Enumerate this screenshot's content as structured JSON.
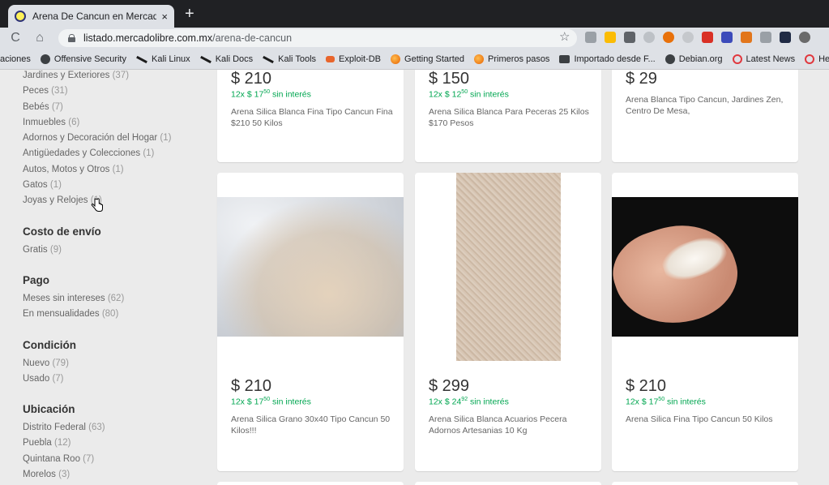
{
  "browser": {
    "tab_title": "Arena De Cancun en Mercado Libre",
    "tab_close": "×",
    "new_tab": "+",
    "back": "C",
    "home": "⌂",
    "url_host": "listado.mercadolibre.com.mx",
    "url_path": "/arena-de-cancun",
    "star": "☆"
  },
  "bookmarks": [
    {
      "label": "aciones",
      "icon": ""
    },
    {
      "label": "Offensive Security",
      "icon": "globe"
    },
    {
      "label": "Kali Linux",
      "icon": "kali"
    },
    {
      "label": "Kali Docs",
      "icon": "kali"
    },
    {
      "label": "Kali Tools",
      "icon": "kali"
    },
    {
      "label": "Exploit-DB",
      "icon": "exploit"
    },
    {
      "label": "Getting Started",
      "icon": "firefox"
    },
    {
      "label": "Primeros pasos",
      "icon": "firefox"
    },
    {
      "label": "Importado desde F...",
      "icon": "folder"
    },
    {
      "label": "Debian.org",
      "icon": "globe"
    },
    {
      "label": "Latest News",
      "icon": "rss"
    },
    {
      "label": "Help",
      "icon": "rss"
    }
  ],
  "sidebar": {
    "top_items": [
      {
        "label": "Jardines y Exteriores",
        "count": "(37)"
      },
      {
        "label": "Peces",
        "count": "(31)"
      },
      {
        "label": "Bebés",
        "count": "(7)"
      },
      {
        "label": "Inmuebles",
        "count": "(6)"
      },
      {
        "label": "Adornos y Decoración del Hogar",
        "count": "(1)"
      },
      {
        "label": "Antigüedades y Colecciones",
        "count": "(1)"
      },
      {
        "label": "Autos, Motos y Otros",
        "count": "(1)"
      },
      {
        "label": "Gatos",
        "count": "(1)"
      },
      {
        "label": "Joyas y Relojes",
        "count": "(1)"
      }
    ],
    "shipping": {
      "heading": "Costo de envío",
      "items": [
        {
          "label": "Gratis",
          "count": "(9)"
        }
      ]
    },
    "payment": {
      "heading": "Pago",
      "items": [
        {
          "label": "Meses sin intereses",
          "count": "(62)"
        },
        {
          "label": "En mensualidades",
          "count": "(80)"
        }
      ]
    },
    "condition": {
      "heading": "Condición",
      "items": [
        {
          "label": "Nuevo",
          "count": "(79)"
        },
        {
          "label": "Usado",
          "count": "(7)"
        }
      ]
    },
    "location": {
      "heading": "Ubicación",
      "items": [
        {
          "label": "Distrito Federal",
          "count": "(63)"
        },
        {
          "label": "Puebla",
          "count": "(12)"
        },
        {
          "label": "Quintana Roo",
          "count": "(7)"
        },
        {
          "label": "Morelos",
          "count": "(3)"
        }
      ]
    }
  },
  "results_row1": [
    {
      "price": "$ 210",
      "install_prefix": "12x $ 17",
      "install_cents": "50",
      "install_suffix": "sin interés",
      "title": "Arena Silica Blanca Fina Tipo Cancun Fina $210 50 Kilos"
    },
    {
      "price": "$ 150",
      "install_prefix": "12x $ 12",
      "install_cents": "50",
      "install_suffix": "sin interés",
      "title": "Arena Silica Blanca Para Peceras 25 Kilos $170 Pesos"
    },
    {
      "price": "$ 29",
      "title": "Arena Blanca Tipo Cancun, Jardines Zen, Centro De Mesa,"
    }
  ],
  "results_row2": [
    {
      "price": "$ 210",
      "install_prefix": "12x $ 17",
      "install_cents": "50",
      "install_suffix": "sin interés",
      "title": "Arena Silica Grano 30x40 Tipo Cancun 50 Kilos!!!",
      "photo": "sand-bag-photo"
    },
    {
      "price": "$ 299",
      "install_prefix": "12x $ 24",
      "install_cents": "92",
      "install_suffix": "sin interés",
      "title": "Arena Silica Blanca Acuarios Pecera Adornos Artesanias 10 Kg",
      "photo": "sand-closeup-photo"
    },
    {
      "price": "$ 210",
      "install_prefix": "12x $ 17",
      "install_cents": "50",
      "install_suffix": "sin interés",
      "title": "Arena Silica Fina Tipo Cancun 50 Kilos",
      "photo": "sand-in-hand-photo"
    }
  ],
  "colors": {
    "installment_green": "#00a650",
    "page_bg": "#ebebeb",
    "chrome_dark": "#202124"
  }
}
